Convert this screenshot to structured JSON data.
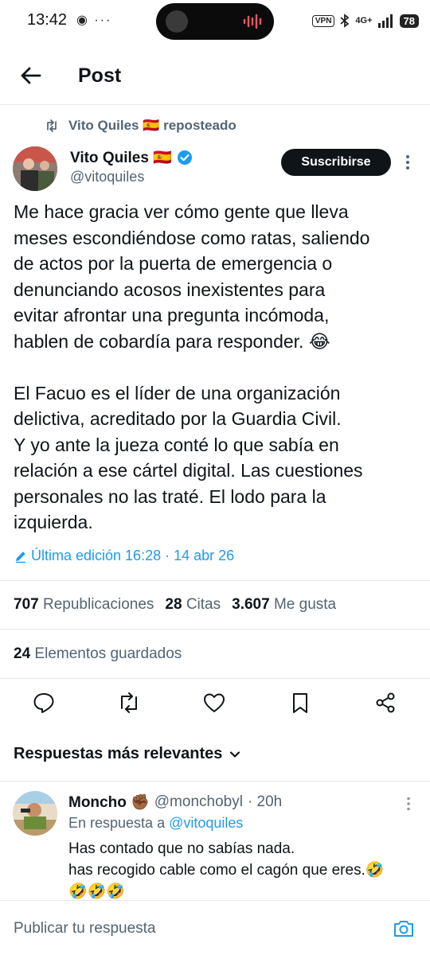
{
  "status_bar": {
    "time": "13:42",
    "left_icons": "◉ ···",
    "vpn": "VPN",
    "network": "4G+",
    "battery": "78"
  },
  "header": {
    "title": "Post"
  },
  "repost": {
    "text": "Vito Quiles 🇪🇸 reposteado"
  },
  "author": {
    "name": "Vito Quiles 🇪🇸",
    "handle": "@vitoquiles",
    "subscribe_label": "Suscribirse"
  },
  "post": {
    "paragraph1": [
      "Me hace gracia ver cómo gente que lleva",
      "meses escondiéndose como ratas, saliendo",
      "de actos por la puerta de emergencia o",
      "denunciando acosos inexistentes para",
      "evitar afrontar una pregunta incómoda,",
      "hablen de cobardía para responder. 😂"
    ],
    "paragraph2": [
      "El Facuo es el líder de una organización",
      "delictiva, acreditado por la Guardia Civil.",
      "Y yo ante la jueza conté lo que sabía en",
      "relación a ese cártel digital. Las cuestiones",
      "personales no las traté. El lodo para la",
      "izquierda."
    ],
    "edited": "Última edición 16:28 · 14 abr 26"
  },
  "stats": {
    "reposts_count": "707",
    "reposts_label": "Republicaciones",
    "quotes_count": "28",
    "quotes_label": "Citas",
    "likes_count": "3.607",
    "likes_label": "Me gusta",
    "bookmarks_count": "24",
    "bookmarks_label": "Elementos guardados"
  },
  "replies": {
    "header": "Respuestas más relevantes",
    "items": [
      {
        "name": "Moncho ✊🏾",
        "handle": "@monchobyl",
        "time": "· 20h",
        "context_prefix": "En respuesta a",
        "context_mention": "@vitoquiles",
        "lines": [
          "Has contado que no sabías nada.",
          "has recogido cable como el cagón que eres.🤣",
          "🤣🤣🤣"
        ]
      }
    ]
  },
  "composer": {
    "placeholder": "Publicar tu respuesta"
  },
  "colors": {
    "accent": "#1d9bf0",
    "text": "#0f1419",
    "muted": "#536471",
    "verified": "#1d9bf0"
  }
}
